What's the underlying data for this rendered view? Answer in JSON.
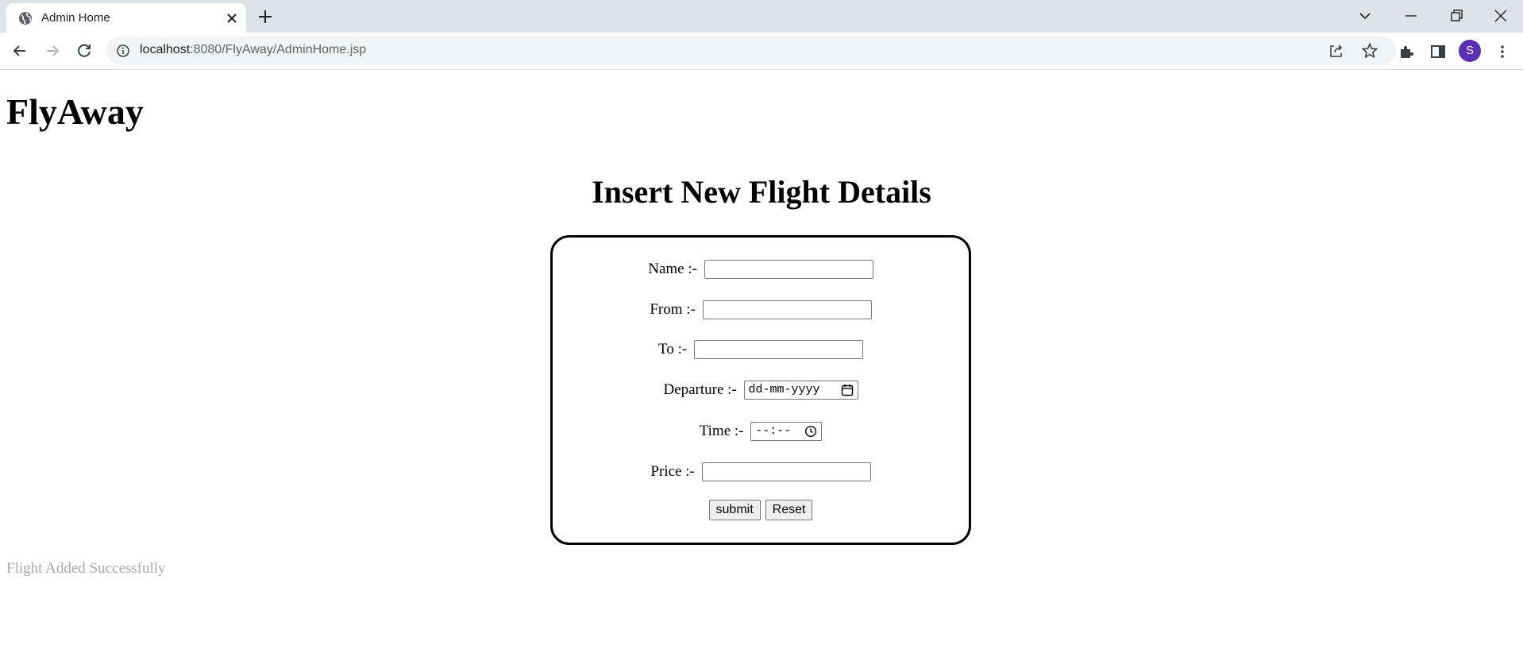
{
  "browser": {
    "tab_title": "Admin Home",
    "url_host": "localhost",
    "url_rest": ":8080/FlyAway/AdminHome.jsp",
    "profile_initial": "S"
  },
  "page": {
    "brand": "FlyAway",
    "heading": "Insert New Flight Details",
    "status_message": "Flight Added Successfully",
    "status_color": "#a9a9a9"
  },
  "form": {
    "name_label": "Name :-",
    "from_label": "From :-",
    "to_label": "To :-",
    "departure_label": "Departure :-",
    "departure_placeholder": "dd-mm-yyyy",
    "time_label": "Time :-",
    "time_placeholder": "--:--",
    "price_label": "Price :-",
    "submit_label": "submit",
    "reset_label": "Reset"
  }
}
